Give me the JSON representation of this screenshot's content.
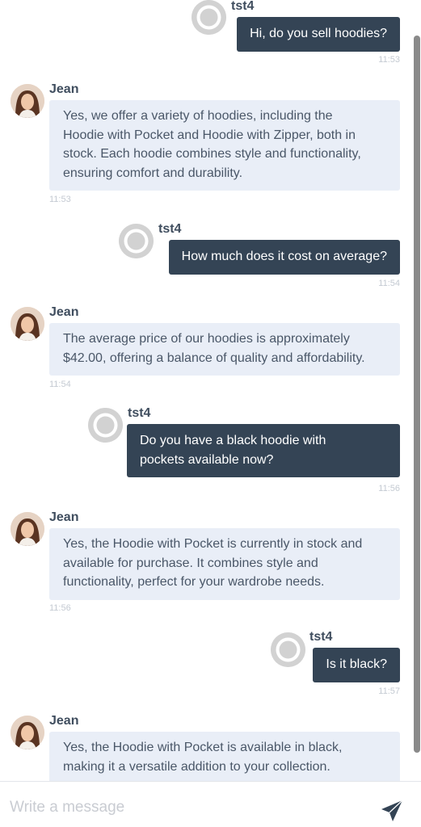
{
  "conversation": [
    {
      "sender": "tst4",
      "text": [
        "Hi, do you sell hoodies?"
      ],
      "time": "11:53"
    },
    {
      "sender": "Jean",
      "text": [
        "Yes, we offer a variety of hoodies, including the",
        "Hoodie with Pocket and Hoodie with Zipper, both in",
        "stock. Each hoodie combines style and functionality,",
        "ensuring comfort and durability."
      ],
      "time": "11:53"
    },
    {
      "sender": "tst4",
      "text": [
        "How much does it cost on average?"
      ],
      "time": "11:54"
    },
    {
      "sender": "Jean",
      "text": [
        "The average price of our hoodies is approximately",
        "$42.00, offering a balance of quality and affordability."
      ],
      "time": "11:54"
    },
    {
      "sender": "tst4",
      "text": [
        "Do you have a black hoodie with",
        "pockets available now?"
      ],
      "time": "11:56"
    },
    {
      "sender": "Jean",
      "text": [
        "Yes, the Hoodie with Pocket is currently in stock and",
        "available for purchase. It combines style and",
        "functionality, perfect for your wardrobe needs."
      ],
      "time": "11:56"
    },
    {
      "sender": "tst4",
      "text": [
        "Is it black?"
      ],
      "time": "11:57"
    },
    {
      "sender": "Jean",
      "text": [
        "Yes, the Hoodie with Pocket is available in black,",
        "making it a versatile addition to your collection."
      ],
      "time": ""
    }
  ],
  "composer": {
    "placeholder": "Write a message"
  },
  "icons": {
    "user_avatar": "default-user-avatar-icon",
    "agent_avatar": "agent-portrait",
    "send": "paper-plane-icon"
  },
  "colors": {
    "user_bubble": "#344455",
    "agent_bubble": "#e9eef7",
    "send_icon": "#344455"
  }
}
